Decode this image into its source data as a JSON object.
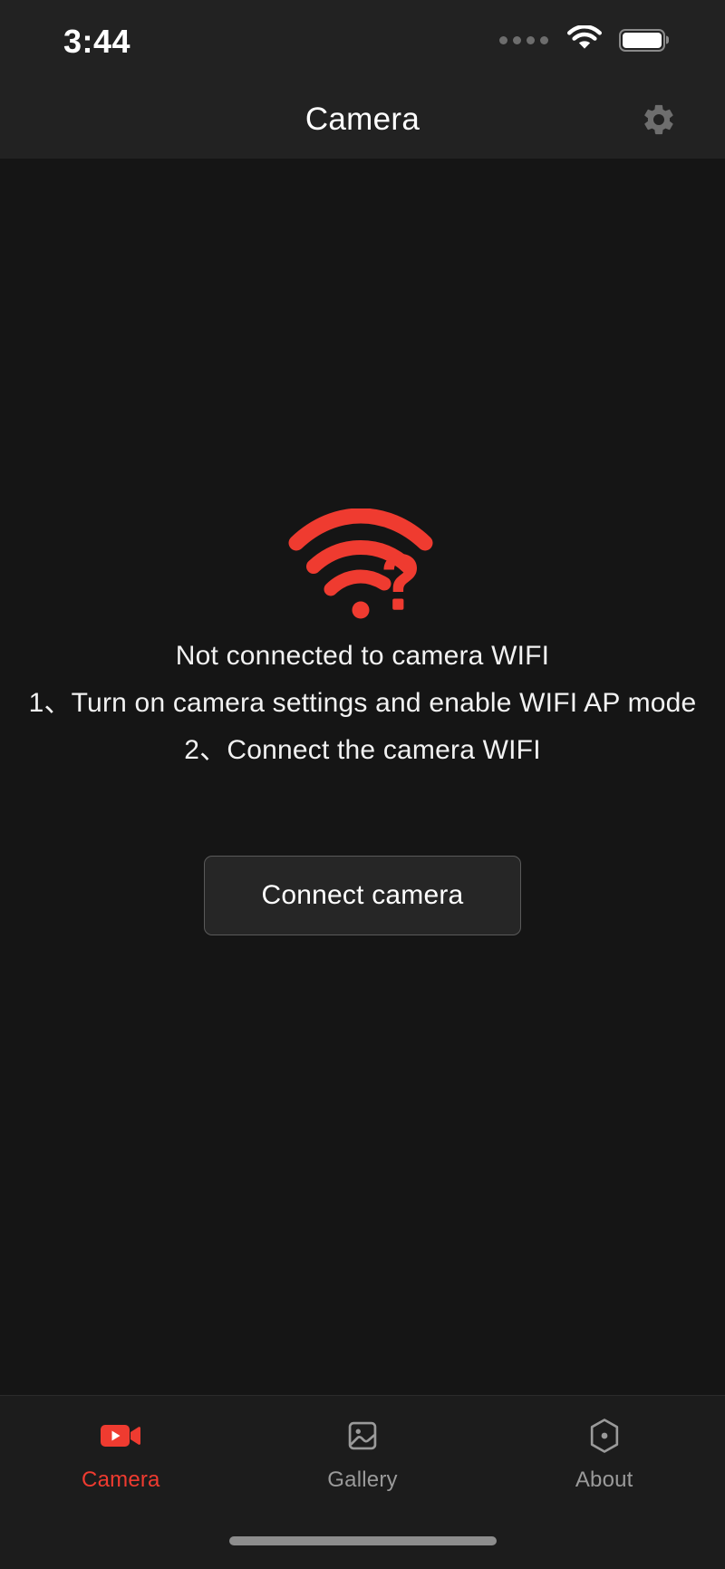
{
  "status_bar": {
    "time": "3:44",
    "signal_icon": "signal-dots-icon",
    "signal_dots": 4,
    "wifi_icon": "wifi-icon",
    "battery_icon": "battery-full-icon",
    "battery_level": 100
  },
  "header": {
    "title": "Camera",
    "settings_icon": "gear-icon"
  },
  "main": {
    "status_icon": "wifi-question-icon",
    "status_icon_color": "#ef3b30",
    "message": "Not connected to camera WIFI",
    "steps": [
      "1、Turn on camera settings and enable WIFI AP mode",
      "2、Connect the camera WIFI"
    ],
    "connect_button": "Connect camera"
  },
  "tabbar": {
    "items": [
      {
        "label": "Camera",
        "icon": "video-camera-icon",
        "active": true
      },
      {
        "label": "Gallery",
        "icon": "image-icon",
        "active": false
      },
      {
        "label": "About",
        "icon": "hexagon-dot-icon",
        "active": false
      }
    ],
    "active_color": "#ef3b30",
    "inactive_color": "#9a9a9a"
  },
  "theme": {
    "background": "#151515",
    "bar_background": "#222222",
    "tabbar_background": "#1c1c1c",
    "accent": "#ef3b30",
    "text": "#f2f2f2"
  }
}
